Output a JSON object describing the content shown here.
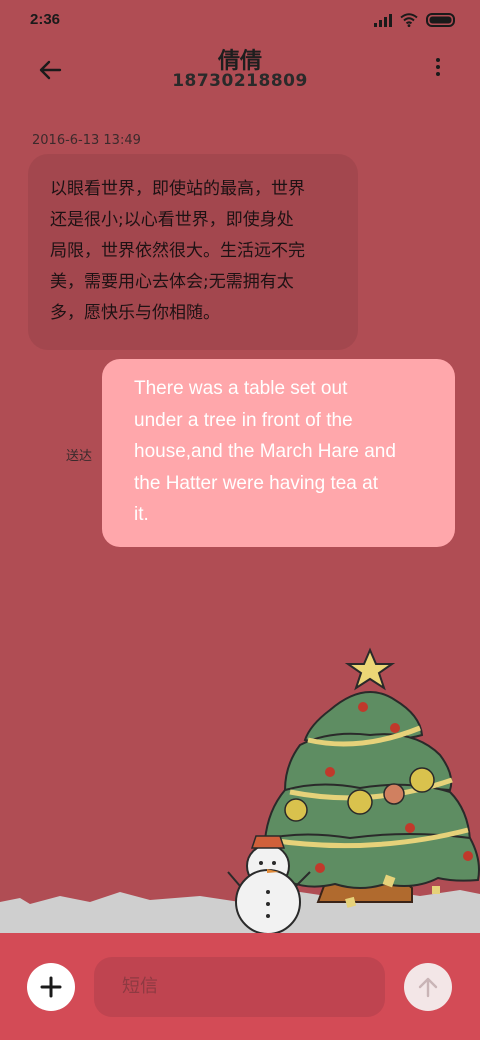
{
  "status": {
    "time": "2:36"
  },
  "header": {
    "name": "倩倩",
    "number": "18730218809"
  },
  "conversation": {
    "timestamp": "2016-6-13 13:49",
    "incoming": [
      "以眼看世界，即使站的最高，世界",
      "还是很小;以心看世界，即使身处",
      "局限，世界依然很大。生活远不完",
      "美，需要用心去体会;无需拥有太",
      "多，愿快乐与你相随。"
    ],
    "outgoing": [
      "There was a table set out",
      "under a tree in front of the",
      "house,and the March Hare and",
      "the Hatter were having tea at",
      "it."
    ],
    "sent_status": "送达"
  },
  "composer": {
    "placeholder": "短信"
  },
  "colors": {
    "background": "#b04d54",
    "incoming_bubble": "#a3474e",
    "outgoing_bubble": "#ffa7ab",
    "input_bar": "#d34b56"
  },
  "icons": [
    "signal-icon",
    "wifi-icon",
    "battery-icon",
    "back-arrow-icon",
    "more-vertical-icon",
    "plus-icon",
    "send-arrow-icon"
  ]
}
